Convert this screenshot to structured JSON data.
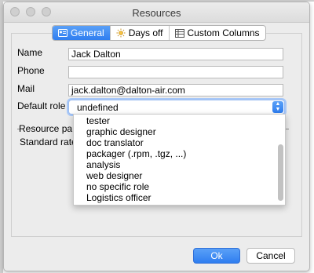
{
  "window": {
    "title": "Resources"
  },
  "tabs": [
    {
      "label": "General",
      "icon": "general-tab-icon",
      "active": true
    },
    {
      "label": "Days off",
      "icon": "sun-icon"
    },
    {
      "label": "Custom Columns",
      "icon": "table-icon"
    }
  ],
  "form": {
    "name_label": "Name",
    "name_value": "Jack Dalton",
    "phone_label": "Phone",
    "phone_value": "",
    "mail_label": "Mail",
    "mail_value": "jack.dalton@dalton-air.com",
    "role_label": "Default role",
    "role_value": "undefined",
    "resource_pay_label": "Resource pa",
    "standard_rate_label": "Standard rate"
  },
  "role_options": [
    "tester",
    "graphic designer",
    "doc translator",
    "packager (.rpm, .tgz, ...)",
    "analysis",
    "web designer",
    "no specific role",
    "Logistics officer"
  ],
  "buttons": {
    "ok": "Ok",
    "cancel": "Cancel"
  },
  "colors": {
    "accent": "#2f7ef0",
    "window_bg": "#ececec"
  }
}
